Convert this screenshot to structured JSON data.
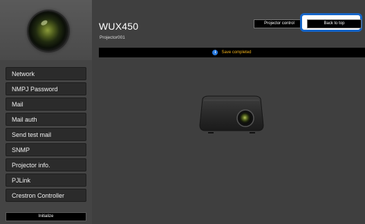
{
  "sidebar": {
    "items": [
      {
        "label": "Network"
      },
      {
        "label": "NMPJ Password"
      },
      {
        "label": "Mail"
      },
      {
        "label": "Mail auth"
      },
      {
        "label": "Send test mail"
      },
      {
        "label": "SNMP"
      },
      {
        "label": "Projector info."
      },
      {
        "label": "PJLink"
      },
      {
        "label": "Crestron Controller"
      }
    ],
    "initialize_label": "Initialize"
  },
  "header": {
    "model": "WUX450",
    "projector_name": "Projector001",
    "projector_control_label": "Projector control",
    "back_to_top_label": "Back to top"
  },
  "status": {
    "icon": "info-icon",
    "icon_glyph": "i",
    "message": "Save completed",
    "message_color": "#f2b21b"
  },
  "colors": {
    "background": "#3f3f3f",
    "sidebar": "#444444",
    "highlight": "#1565c8"
  }
}
